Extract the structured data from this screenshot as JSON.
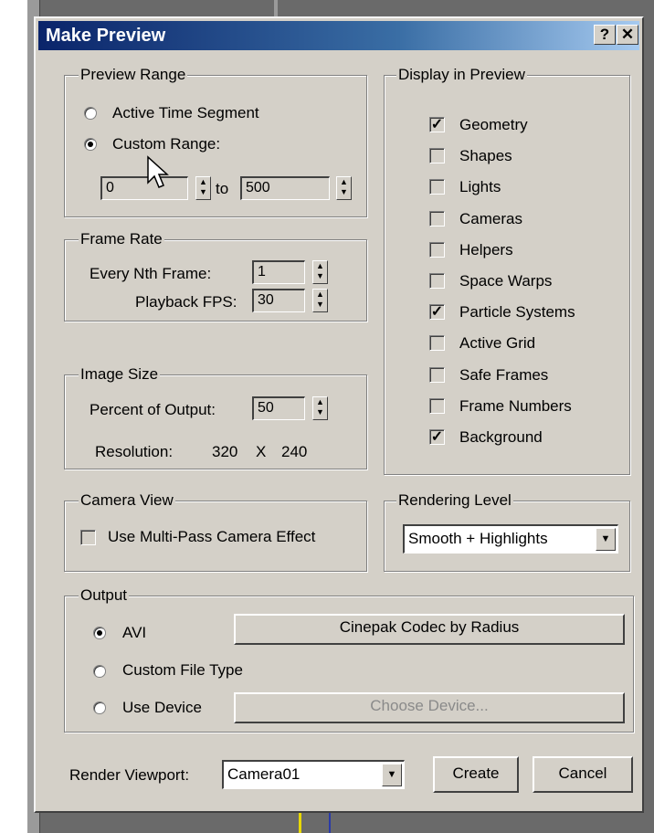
{
  "dialog": {
    "title": "Make Preview",
    "help_label": "?",
    "close_label": "✕"
  },
  "preview_range": {
    "label": "Preview Range",
    "active_time_segment": "Active Time Segment",
    "custom_range": "Custom Range:",
    "from_value": "0",
    "to_label": "to",
    "to_value": "500",
    "selected": "Custom Range"
  },
  "frame_rate": {
    "label": "Frame Rate",
    "every_nth_label": "Every Nth Frame:",
    "every_nth_value": "1",
    "fps_label": "Playback FPS:",
    "fps_value": "30"
  },
  "image_size": {
    "label": "Image Size",
    "percent_label": "Percent of Output:",
    "percent_value": "50",
    "resolution_label": "Resolution:",
    "resolution_width": "320",
    "resolution_x": "X",
    "resolution_height": "240"
  },
  "camera_view": {
    "label": "Camera View",
    "multipass": "Use Multi-Pass Camera Effect",
    "multipass_checked": false
  },
  "display": {
    "label": "Display in Preview",
    "items": [
      {
        "label": "Geometry",
        "checked": true,
        "mark": "✓"
      },
      {
        "label": "Shapes",
        "checked": false,
        "mark": ""
      },
      {
        "label": "Lights",
        "checked": false,
        "mark": ""
      },
      {
        "label": "Cameras",
        "checked": false,
        "mark": ""
      },
      {
        "label": "Helpers",
        "checked": false,
        "mark": ""
      },
      {
        "label": "Space Warps",
        "checked": false,
        "mark": ""
      },
      {
        "label": "Particle Systems",
        "checked": true,
        "mark": "✓"
      },
      {
        "label": "Active Grid",
        "checked": false,
        "mark": ""
      },
      {
        "label": "Safe Frames",
        "checked": false,
        "mark": ""
      },
      {
        "label": "Frame Numbers",
        "checked": false,
        "mark": ""
      },
      {
        "label": "Background",
        "checked": true,
        "mark": "✓"
      }
    ]
  },
  "rendering_level": {
    "label": "Rendering Level",
    "value": "Smooth + Highlights"
  },
  "output": {
    "label": "Output",
    "avi": "AVI",
    "custom_file_type": "Custom File Type",
    "use_device": "Use Device",
    "codec_button": "Cinepak Codec by Radius",
    "choose_device_button": "Choose Device...",
    "selected": "AVI"
  },
  "footer": {
    "render_viewport_label": "Render Viewport:",
    "render_viewport_value": "Camera01",
    "create": "Create",
    "cancel": "Cancel"
  },
  "icons": {
    "spinner": "spinner-arrows-icon",
    "dropdown": "chevron-down-icon",
    "cursor": "mouse-pointer-icon"
  },
  "colors": {
    "title_start": "#0a246a",
    "title_end": "#a6caf0",
    "dialog_bg": "#d4d0c8"
  }
}
